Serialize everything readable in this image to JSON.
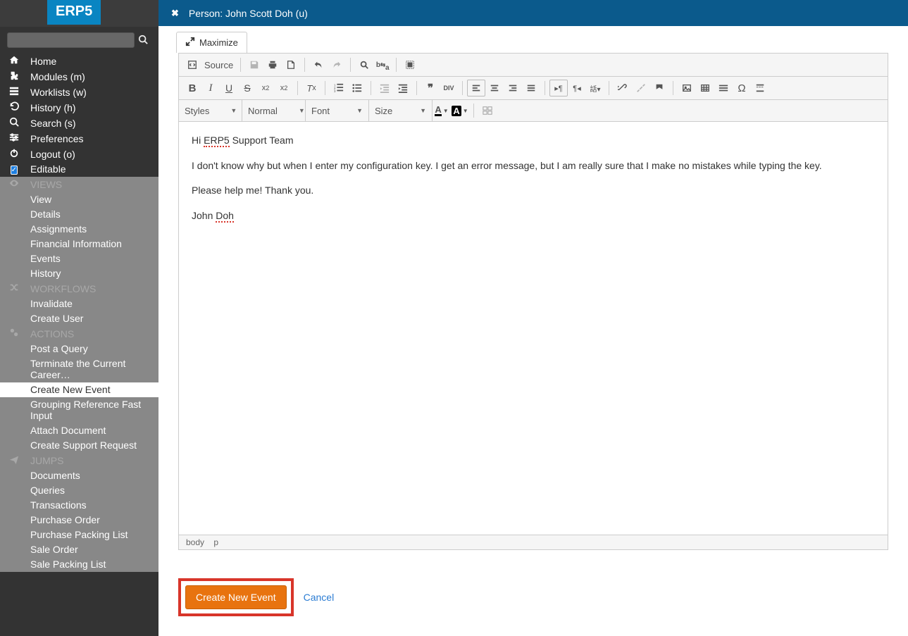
{
  "logo": "ERP5",
  "nav_top": [
    {
      "icon": "home",
      "label": "Home"
    },
    {
      "icon": "puzzle",
      "label": "Modules (m)"
    },
    {
      "icon": "list",
      "label": "Worklists (w)"
    },
    {
      "icon": "history",
      "label": "History (h)"
    },
    {
      "icon": "search",
      "label": "Search (s)"
    },
    {
      "icon": "prefs",
      "label": "Preferences"
    },
    {
      "icon": "power",
      "label": "Logout (o)"
    }
  ],
  "editable_label": "Editable",
  "sections": {
    "views": {
      "title": "VIEWS",
      "items": [
        "View",
        "Details",
        "Assignments",
        "Financial Information",
        "Events",
        "History"
      ]
    },
    "workflows": {
      "title": "WORKFLOWS",
      "items": [
        "Invalidate",
        "Create User"
      ]
    },
    "actions": {
      "title": "ACTIONS",
      "items": [
        "Post a Query",
        "Terminate the Current Career…",
        "Create New Event",
        "Grouping Reference Fast Input",
        "Attach Document",
        "Create Support Request"
      ],
      "active": 2
    },
    "jumps": {
      "title": "JUMPS",
      "items": [
        "Documents",
        "Queries",
        "Transactions",
        "Purchase Order",
        "Purchase Packing List",
        "Sale Order",
        "Sale Packing List"
      ]
    }
  },
  "header": {
    "title": "Person: John Scott Doh (u)"
  },
  "maximize_label": "Maximize",
  "toolbar": {
    "source_label": "Source",
    "styles_label": "Styles",
    "format_label": "Normal",
    "font_label": "Font",
    "size_label": "Size"
  },
  "editor_body": {
    "l1a": "Hi ",
    "l1b": "ERP5",
    "l1c": " Support Team",
    "l2": "I don't know why but when I enter my configuration key. I get an error message, but I am really sure that I make no mistakes while typing the key.",
    "l3": "Please help me! Thank you.",
    "l4a": "John ",
    "l4b": "Doh"
  },
  "path": {
    "p1": "body",
    "p2": "p"
  },
  "buttons": {
    "create": "Create New Event",
    "cancel": "Cancel"
  }
}
